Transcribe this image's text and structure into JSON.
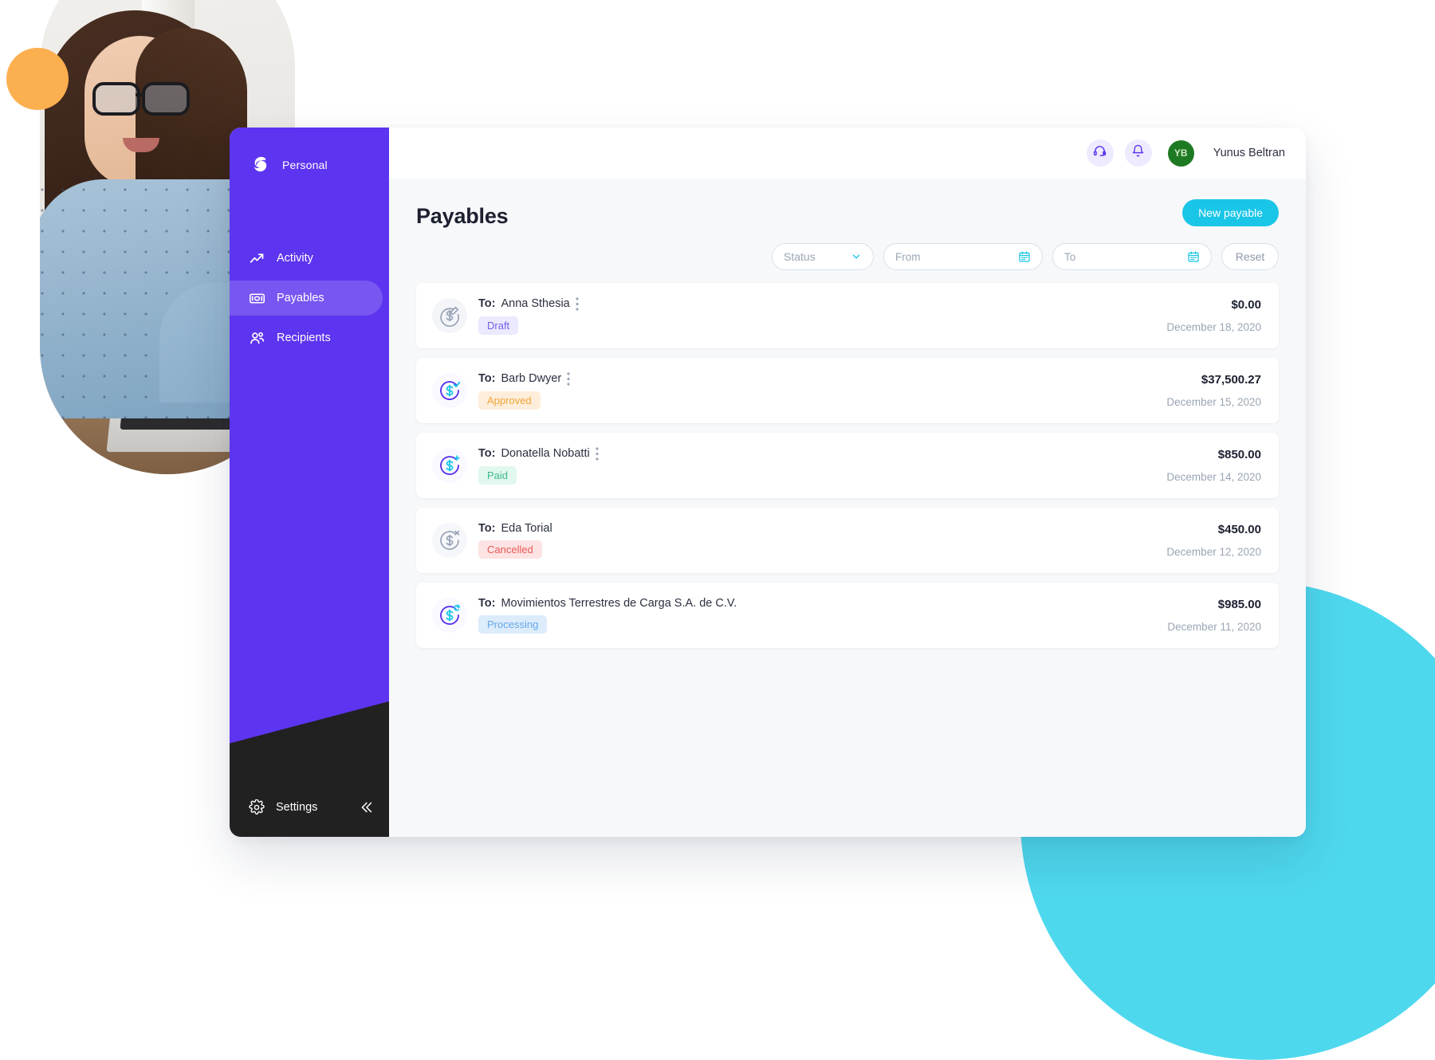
{
  "brand": {
    "name": "Personal",
    "logo_icon": "s-logo-icon"
  },
  "sidebar": {
    "items": [
      {
        "label": "Activity",
        "icon": "trend-up-icon",
        "active": false
      },
      {
        "label": "Payables",
        "icon": "banknote-icon",
        "active": true
      },
      {
        "label": "Recipients",
        "icon": "people-icon",
        "active": false
      }
    ],
    "settings_label": "Settings",
    "settings_icon": "gear-icon",
    "collapse_icon": "double-chevron-left-icon"
  },
  "topbar": {
    "support_icon": "headset-icon",
    "notifications_icon": "bell-icon",
    "avatar_initials": "YB",
    "user_name": "Yunus Beltran"
  },
  "page": {
    "title": "Payables",
    "new_payable_label": "New payable"
  },
  "filters": {
    "status_label": "Status",
    "status_chevron_icon": "chevron-down-icon",
    "from_placeholder": "From",
    "to_placeholder": "To",
    "calendar_icon": "calendar-icon",
    "reset_label": "Reset"
  },
  "payables": {
    "to_prefix": "To:",
    "rows": [
      {
        "recipient": "Anna Sthesia",
        "status": "Draft",
        "status_key": "draft",
        "amount": "$0.00",
        "date": "December 18, 2020",
        "icon": "dollar-circle-pencil-icon",
        "has_menu": true
      },
      {
        "recipient": "Barb Dwyer",
        "status": "Approved",
        "status_key": "approved",
        "amount": "$37,500.27",
        "date": "December 15, 2020",
        "icon": "dollar-circle-check-icon",
        "has_menu": true
      },
      {
        "recipient": "Donatella Nobatti",
        "status": "Paid",
        "status_key": "paid",
        "amount": "$850.00",
        "date": "December 14, 2020",
        "icon": "dollar-circle-paid-icon",
        "has_menu": true
      },
      {
        "recipient": "Eda Torial",
        "status": "Cancelled",
        "status_key": "cancelled",
        "amount": "$450.00",
        "date": "December 12, 2020",
        "icon": "dollar-circle-x-icon",
        "has_menu": false
      },
      {
        "recipient": "Movimientos Terrestres de Carga S.A. de C.V.",
        "status": "Processing",
        "status_key": "processing",
        "amount": "$985.00",
        "date": "December 11, 2020",
        "icon": "dollar-circle-refresh-icon",
        "has_menu": false
      }
    ]
  },
  "colors": {
    "sidebar_purple": "#5d34ef",
    "sidebar_dark": "#212121",
    "accent_cyan": "#1ac6e8",
    "avatar_green": "#1e7a22",
    "deco_orange": "#fbaf4f",
    "deco_cyan": "#4ed8ee",
    "badge_draft_bg": "#ebe9fd",
    "badge_draft_fg": "#6f63e8",
    "badge_approved_bg": "#fdeedb",
    "badge_approved_fg": "#f0a338",
    "badge_paid_bg": "#e2f8ee",
    "badge_paid_fg": "#3bb98a",
    "badge_cancelled_bg": "#fde3e3",
    "badge_cancelled_fg": "#e85757",
    "badge_processing_bg": "#ddecfb",
    "badge_processing_fg": "#64a8e8"
  }
}
